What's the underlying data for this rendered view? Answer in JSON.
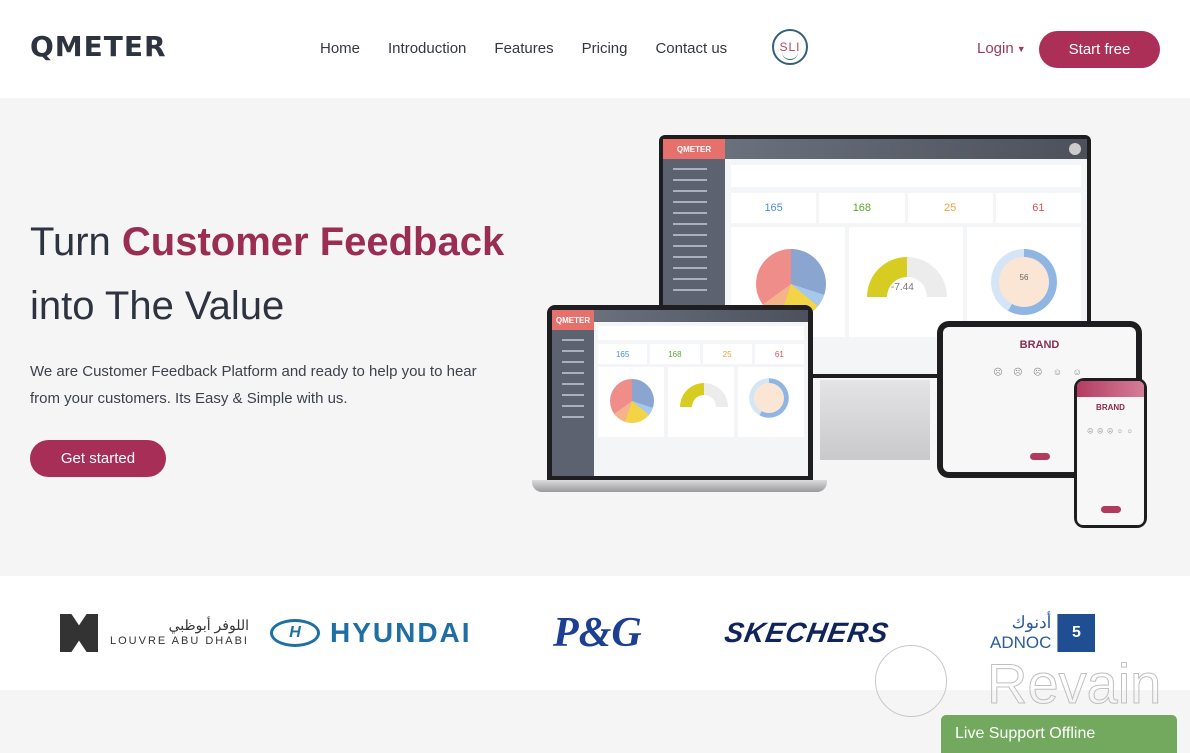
{
  "header": {
    "logo": "QMETER",
    "nav": [
      "Home",
      "Introduction",
      "Features",
      "Pricing",
      "Contact us"
    ],
    "sli_badge": "SLI",
    "login_label": "Login",
    "start_free_label": "Start free"
  },
  "hero": {
    "headline_prefix": "Turn ",
    "headline_accent": "Customer Feedback",
    "headline_line2": "into The Value",
    "subtext": "We are Customer Feedback Platform and ready to help you to hear from your customers. Its Easy & Simple with us.",
    "cta_label": "Get started"
  },
  "mockup": {
    "dashboard_brand": "QMETER",
    "stats": [
      {
        "value": "165",
        "color": "#4a90d9"
      },
      {
        "value": "168",
        "color": "#5aa830"
      },
      {
        "value": "25",
        "color": "#f0a03a"
      },
      {
        "value": "61",
        "color": "#e0505a"
      }
    ],
    "gauge_value": "-7.44",
    "donut_value": "56",
    "tablet_brand": "BRAND",
    "phone_brand": "BRAND",
    "faces": "☹ ☹ ☹ ☺ ☺"
  },
  "partners": {
    "louvre_arabic": "اللوفر أبوظبي",
    "louvre": "LOUVRE ABU DHABI",
    "hyundai": "HYUNDAI",
    "hyundai_mark": "H",
    "pg": "P&G",
    "skechers": "SKECHERS",
    "adnoc_arabic": "أدنوك",
    "adnoc": "ADNOC"
  },
  "watermark": "Revain",
  "live_support": "Live Support Offline",
  "colors": {
    "accent": "#ab2f57",
    "live_support": "#72a95e"
  }
}
